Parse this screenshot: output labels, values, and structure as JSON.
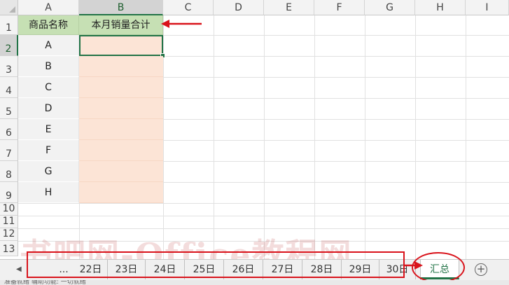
{
  "columns": [
    "A",
    "B",
    "C",
    "D",
    "E",
    "F",
    "G",
    "H",
    "I"
  ],
  "rows": [
    "1",
    "2",
    "3",
    "4",
    "5",
    "6",
    "7",
    "8",
    "9",
    "10",
    "11",
    "12",
    "13"
  ],
  "table": {
    "header_a": "商品名称",
    "header_b": "本月销量合计",
    "items": [
      "A",
      "B",
      "C",
      "D",
      "E",
      "F",
      "G",
      "H"
    ],
    "header_color": "#c6e0b4",
    "value_color": "#fce4d6"
  },
  "tabs": {
    "ellipsis": "...",
    "sheets": [
      "22日",
      "23日",
      "24日",
      "25日",
      "26日",
      "27日",
      "28日",
      "29日",
      "30日"
    ],
    "active": "汇总"
  },
  "watermark": "书吧网-Office教程网",
  "status": "准备就绪  辅助功能: 一切就绪",
  "annotation_color": "#d9131b",
  "accent_color": "#217346"
}
